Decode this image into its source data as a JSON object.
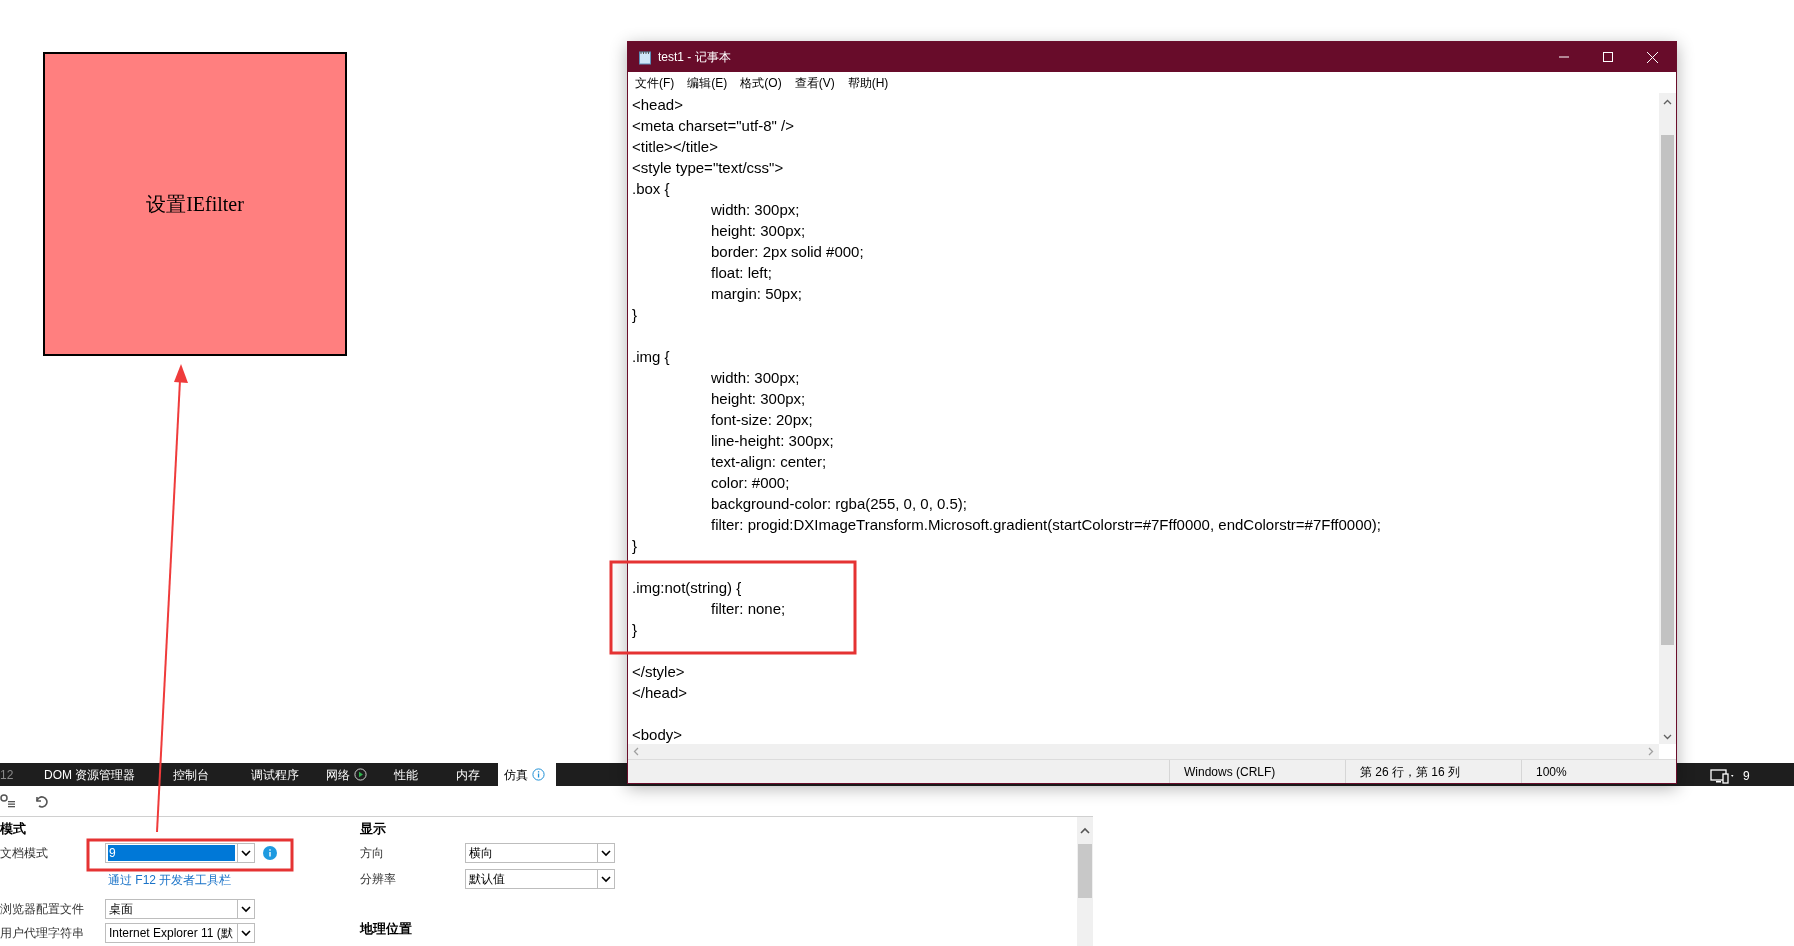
{
  "web_page": {
    "box_text": "设置IEfilter"
  },
  "notepad": {
    "title": "test1 - 记事本",
    "menu": [
      "文件(F)",
      "编辑(E)",
      "格式(O)",
      "查看(V)",
      "帮助(H)"
    ],
    "code_blocks": [
      [
        "<head>",
        "<meta charset=\"utf-8\" />",
        "<title></title>",
        "<style type=\"text/css\">",
        ".box {",
        "\twidth: 300px;",
        "\theight: 300px;",
        "\tborder: 2px solid #000;",
        "\tfloat: left;",
        "\tmargin: 50px;",
        "}"
      ],
      [
        ".img {",
        "\twidth: 300px;",
        "\theight: 300px;",
        "\tfont-size: 20px;",
        "\tline-height: 300px;",
        "\ttext-align: center;",
        "\tcolor: #000;",
        "\tbackground-color: rgba(255, 0, 0, 0.5);",
        "\tfilter: progid:DXImageTransform.Microsoft.gradient(startColorstr=#7Fff0000, endColorstr=#7Fff0000);",
        "}"
      ],
      [
        ".img:not(string) {",
        "\tfilter: none;",
        "}"
      ],
      [
        "</style>",
        "</head>"
      ],
      [
        "<body>"
      ]
    ],
    "status_bar": [
      "Windows (CRLF)",
      "第 26 行，第 16 列",
      "100%"
    ]
  },
  "devtools": {
    "f12_label": "12",
    "tabs": [
      {
        "label": "DOM 资源管理器",
        "selected": false,
        "kind": "plain"
      },
      {
        "label": "控制台",
        "selected": false,
        "kind": "plain"
      },
      {
        "label": "调试程序",
        "selected": false,
        "kind": "plain"
      },
      {
        "label": "网络",
        "selected": false,
        "kind": "play"
      },
      {
        "label": "性能",
        "selected": false,
        "kind": "plain"
      },
      {
        "label": "内存",
        "selected": false,
        "kind": "plain"
      },
      {
        "label": "仿真",
        "selected": true,
        "kind": "info"
      }
    ],
    "target_count": "9",
    "mode": {
      "heading": "模式",
      "document_mode": {
        "label": "文档模式",
        "value": "9",
        "focused": true
      },
      "link": "通过 F12 开发者工具栏",
      "browser_profile": {
        "label": "浏览器配置文件",
        "value": "桌面",
        "focused": false
      },
      "user_agent": {
        "label": "用户代理字符串",
        "value": "Internet Explorer 11 (默",
        "focused": false
      }
    },
    "display": {
      "heading": "显示",
      "orientation": {
        "label": "方向",
        "value": "横向",
        "focused": false
      },
      "resolution": {
        "label": "分辨率",
        "value": "默认值",
        "focused": false
      }
    },
    "geolocation": {
      "heading": "地理位置"
    }
  }
}
